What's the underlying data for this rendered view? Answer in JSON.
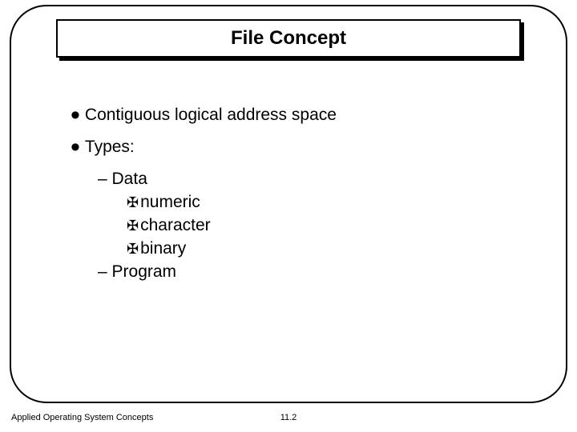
{
  "title": "File Concept",
  "bullets": {
    "b1a": "Contiguous logical address space",
    "b1b": "Types:",
    "b2_data": "–  Data",
    "b3_numeric": "numeric",
    "b3_character": "character",
    "b3_binary": "binary",
    "b2_program": "–  Program"
  },
  "footer": {
    "left": "Applied Operating System Concepts",
    "center": "11.2"
  }
}
